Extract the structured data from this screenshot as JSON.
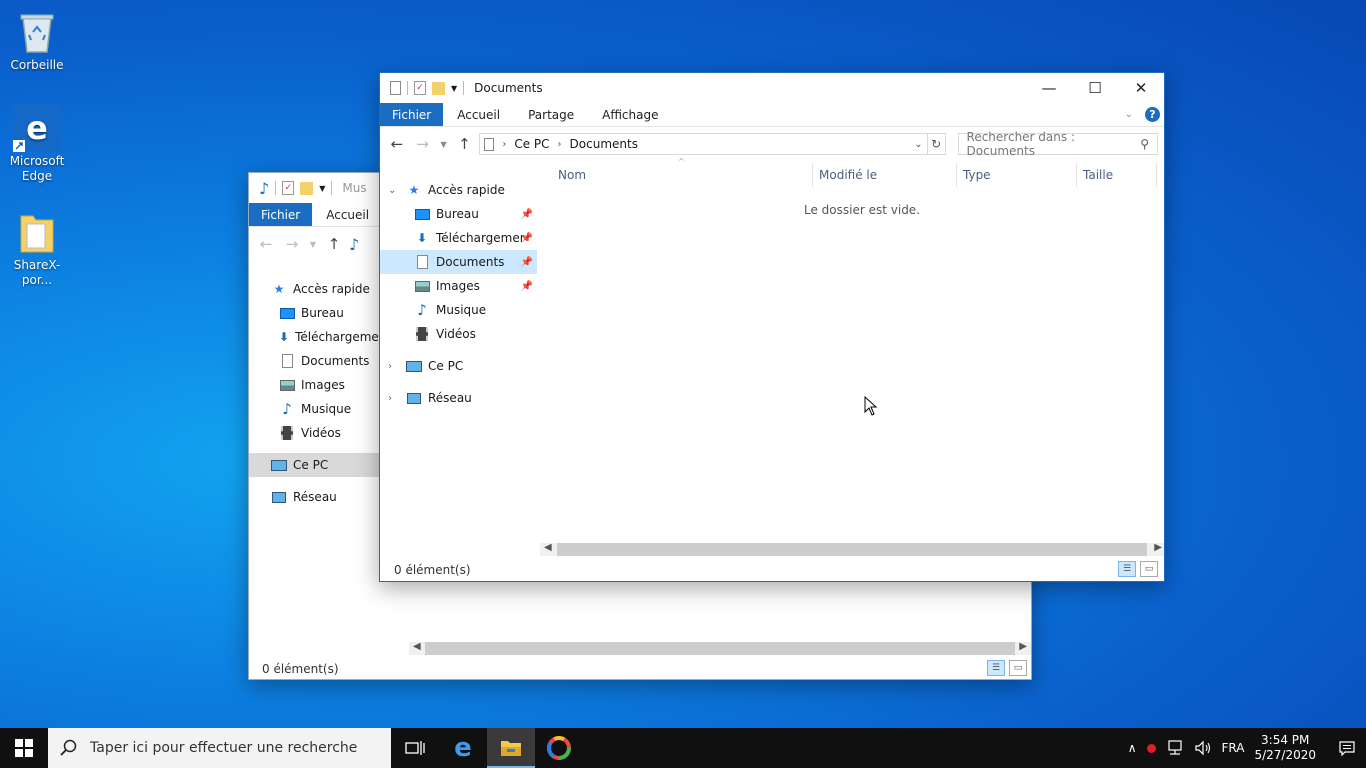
{
  "desktop": {
    "icons": [
      {
        "label": "Corbeille"
      },
      {
        "label": "Microsoft Edge"
      },
      {
        "label": "ShareX-por..."
      }
    ]
  },
  "back_window": {
    "title": "Mus",
    "ribbon": {
      "file": "Fichier",
      "home": "Accueil"
    },
    "nav": {
      "quick_access": "Accès rapide",
      "items": [
        "Bureau",
        "Téléchargemen",
        "Documents",
        "Images",
        "Musique",
        "Vidéos"
      ],
      "this_pc": "Ce PC",
      "network": "Réseau"
    },
    "status": "0 élément(s)"
  },
  "front_window": {
    "title": "Documents",
    "ribbon": {
      "file": "Fichier",
      "home": "Accueil",
      "share": "Partage",
      "view": "Affichage",
      "help": "?"
    },
    "breadcrumb": {
      "root": "Ce PC",
      "current": "Documents"
    },
    "search_placeholder": "Rechercher dans : Documents",
    "nav": {
      "quick_access": "Accès rapide",
      "items": [
        "Bureau",
        "Téléchargements",
        "Documents",
        "Images",
        "Musique",
        "Vidéos"
      ],
      "this_pc": "Ce PC",
      "network": "Réseau"
    },
    "columns": {
      "name": "Nom",
      "modified": "Modifié le",
      "type": "Type",
      "size": "Taille"
    },
    "empty_message": "Le dossier est vide.",
    "status": "0 élément(s)"
  },
  "taskbar": {
    "search_placeholder": "Taper ici pour effectuer une recherche",
    "language": "FRA",
    "time": "3:54 PM",
    "date": "5/27/2020"
  },
  "colors": {
    "accent": "#1a6dc0",
    "selection": "#cce8ff",
    "taskbar": "#101010"
  }
}
